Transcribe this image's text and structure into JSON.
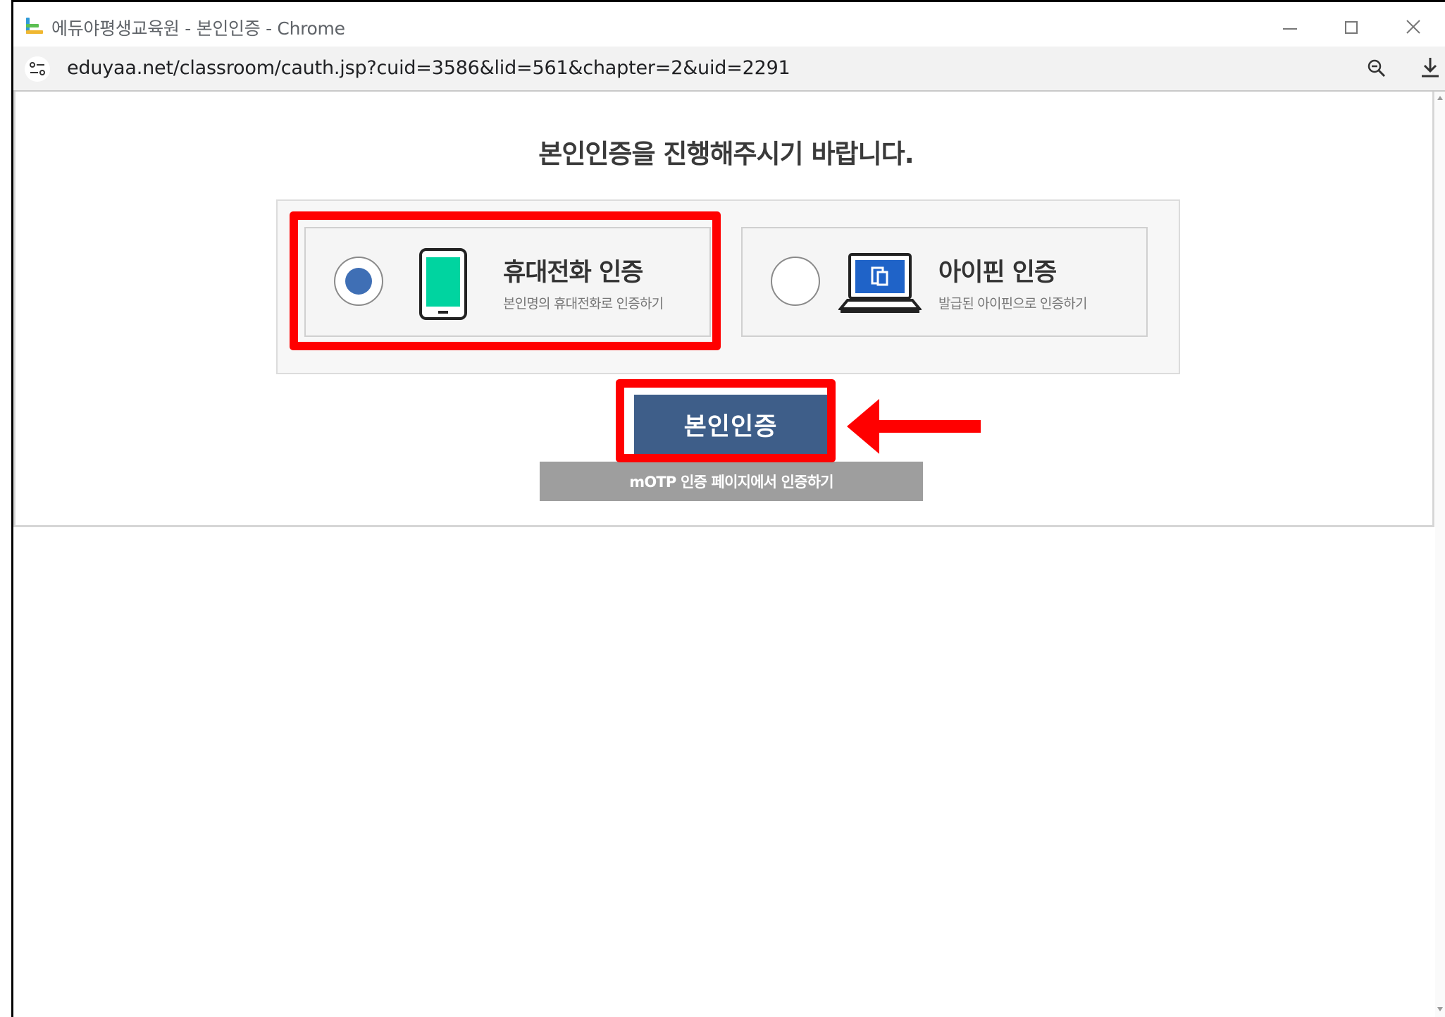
{
  "window": {
    "title": "에듀야평생교육원 - 본인인증 - Chrome",
    "url": "eduyaa.net/classroom/cauth.jsp?cuid=3586&lid=561&chapter=2&uid=2291"
  },
  "page": {
    "heading": "본인인증을 진행해주시기 바랍니다.",
    "options": [
      {
        "title": "휴대전화 인증",
        "subtitle": "본인명의 휴대전화로 인증하기",
        "icon": "smartphone-icon",
        "selected": true
      },
      {
        "title": "아이핀 인증",
        "subtitle": "발급된 아이핀으로 인증하기",
        "icon": "laptop-icon",
        "selected": false
      }
    ],
    "verify_button": "본인인증",
    "motp_button": "mOTP 인증 페이지에서 인증하기"
  },
  "colors": {
    "annotation": "#ff0000",
    "primary_button": "#3e5e89",
    "secondary_button": "#9e9e9e",
    "radio_selected": "#3f6fb5",
    "phone_screen": "#00d4a0"
  }
}
